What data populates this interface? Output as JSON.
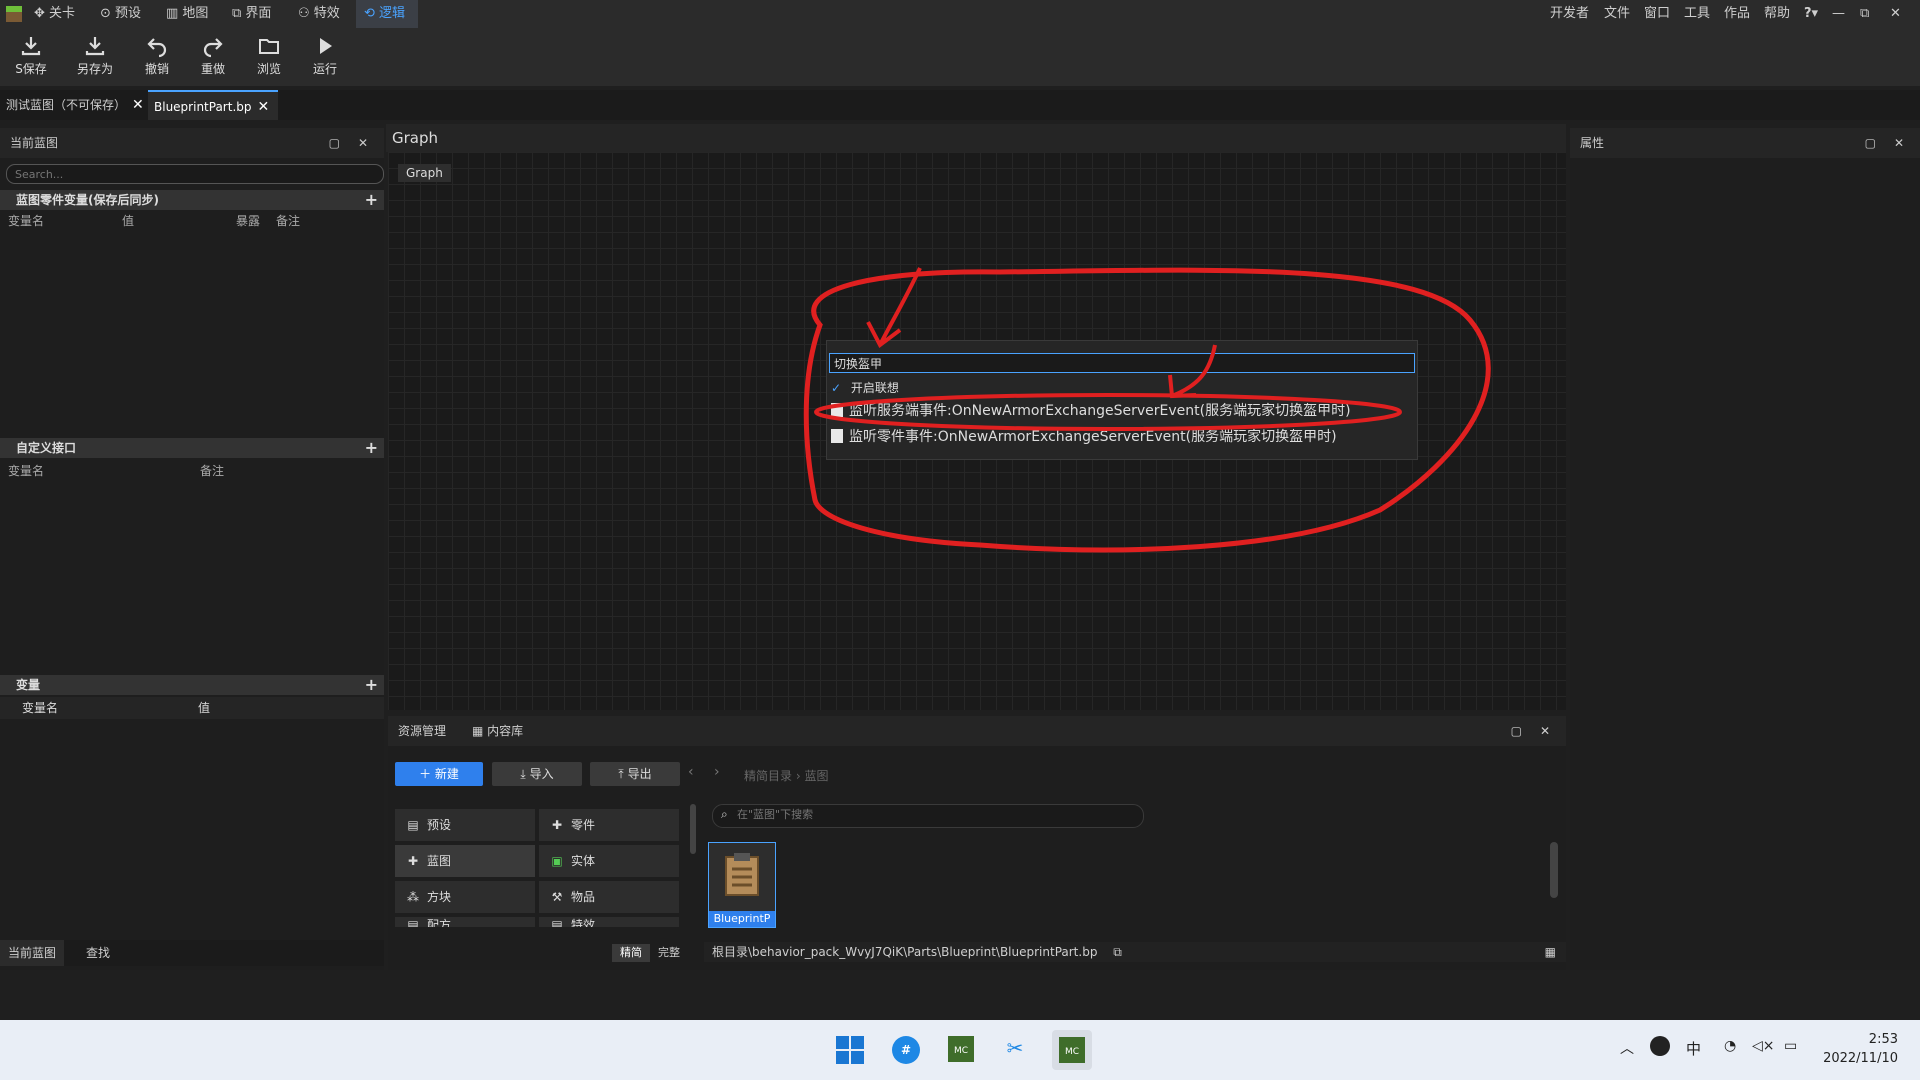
{
  "menubar": {
    "left_items": [
      "关卡",
      "预设",
      "地图",
      "界面",
      "特效",
      "逻辑"
    ],
    "active_item": "逻辑",
    "right_items": [
      "开发者",
      "文件",
      "窗口",
      "工具",
      "作品",
      "帮助"
    ],
    "help_icon": "?"
  },
  "toolbar": {
    "save": "S保存",
    "save_as": "另存为",
    "undo": "撤销",
    "redo": "重做",
    "browse": "浏览",
    "run": "运行"
  },
  "doc_tabs": [
    "测试蓝图（不可保存）",
    "BlueprintPart.bp"
  ],
  "left_panel": {
    "title": "当前蓝图",
    "search_placeholder": "Search...",
    "section1": {
      "title": "蓝图零件变量(保存后同步)",
      "cols": [
        "变量名",
        "值",
        "暴露",
        "备注"
      ]
    },
    "section2": {
      "title": "自定义接口",
      "cols": [
        "变量名",
        "备注"
      ]
    },
    "section3": {
      "title": "变量",
      "cols": [
        "变量名",
        "值"
      ]
    },
    "bottom_tabs": [
      "当前蓝图",
      "查找"
    ]
  },
  "graph": {
    "header": "Graph",
    "breadcrumb": "Graph",
    "popup": {
      "search_value": "切换盔甲",
      "checkbox_label": "开启联想",
      "suggestions": [
        "监听服务端事件:OnNewArmorExchangeServerEvent(服务端玩家切换盔甲时)",
        "监听零件事件:OnNewArmorExchangeServerEvent(服务端玩家切换盔甲时)"
      ]
    }
  },
  "right_panel": {
    "title": "属性"
  },
  "bottom_panel": {
    "tabs": [
      "资源管理",
      "内容库"
    ],
    "new_btn": "新建",
    "import_btn": "导入",
    "export_btn": "导出",
    "breadcrumb": [
      "精简目录",
      "蓝图"
    ],
    "search_placeholder": "在\"蓝图\"下搜索",
    "categories": [
      "预设",
      "零件",
      "蓝图",
      "实体",
      "方块",
      "物品",
      "配方",
      "特效"
    ],
    "mode_toggle": [
      "精简",
      "完整"
    ],
    "file_item": "BlueprintP",
    "path": "根目录\\behavior_pack_WvyJ7QiK\\Parts\\Blueprint\\BlueprintPart.bp"
  },
  "taskbar": {
    "time": "2:53",
    "date": "2022/11/10",
    "ime": "中"
  },
  "colors": {
    "accent": "#4aa3ff",
    "annotation": "#e02020",
    "new_button": "#2f80ed"
  }
}
